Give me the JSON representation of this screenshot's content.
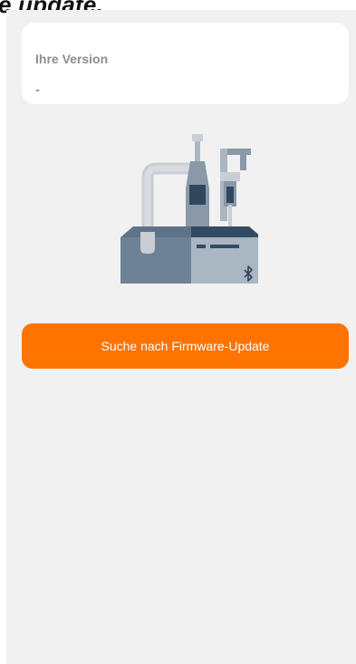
{
  "header": {
    "title_fragment": "e update."
  },
  "version_card": {
    "label": "Ihre Version",
    "value": "-"
  },
  "illustration": {
    "icon": "firmware-device-bluetooth-illustration"
  },
  "actions": {
    "search_update_label": "Suche nach Firmware-Update"
  },
  "colors": {
    "accent": "#ff7300",
    "background": "#f1f1f1",
    "card": "#ffffff"
  }
}
